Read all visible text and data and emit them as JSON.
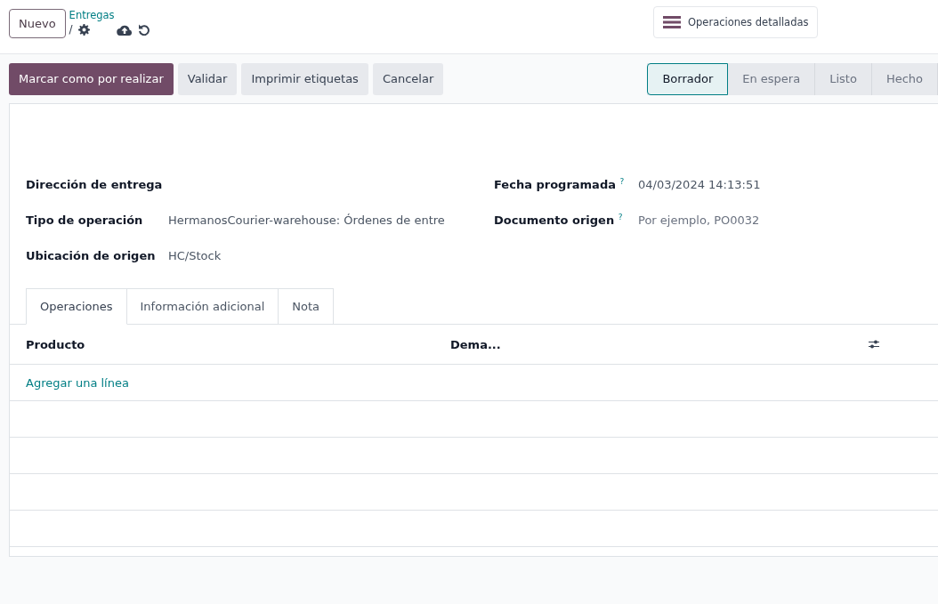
{
  "control_panel": {
    "new_button": "Nuevo",
    "breadcrumb": "Entregas",
    "separator": "/",
    "detailed_button": "Operaciones detalladas"
  },
  "actions": [
    {
      "label": "Marcar como por realizar",
      "kind": "primary"
    },
    {
      "label": "Validar",
      "kind": "secondary"
    },
    {
      "label": "Imprimir etiquetas",
      "kind": "secondary"
    },
    {
      "label": "Cancelar",
      "kind": "secondary"
    }
  ],
  "status_steps": [
    {
      "label": "Borrador",
      "selected": true
    },
    {
      "label": "En espera",
      "selected": false
    },
    {
      "label": "Listo",
      "selected": false
    },
    {
      "label": "Hecho",
      "selected": false
    }
  ],
  "fields_left": [
    {
      "label": "Dirección de entrega"
    },
    {
      "label": "Tipo de operación",
      "value": "HermanosCourier-warehouse: Órdenes de entre"
    },
    {
      "label": "Ubicación de origen",
      "value": "HC/Stock"
    }
  ],
  "fields_right": [
    {
      "label": "Fecha programada $^{?}$",
      "value": "04/03/2024 14:13:51"
    },
    {
      "label": "Documento origen $^{?}$",
      "placeholder": "Por ejemplo, PO0032"
    }
  ],
  "tabs": [
    {
      "label": "Operaciones",
      "selected": true
    },
    {
      "label": "Información adicional",
      "selected": false
    },
    {
      "label": "Nota",
      "selected": false
    }
  ],
  "table": {
    "columns": [
      "Producto",
      "Dema..."
    ],
    "add_line": "Agregar una línea"
  }
}
